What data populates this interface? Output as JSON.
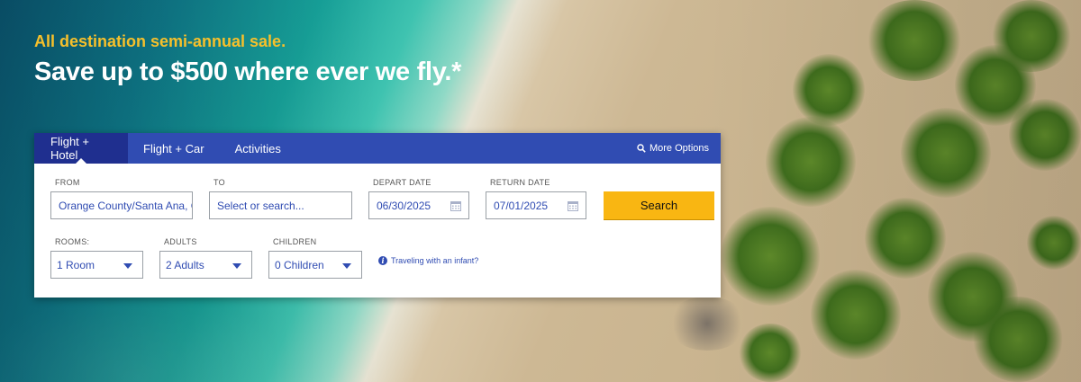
{
  "promo": {
    "kicker": "All destination semi-annual sale.",
    "headline": "Save up to $500 where ever we fly.*"
  },
  "tabs": [
    {
      "label": "Flight + Hotel",
      "active": true
    },
    {
      "label": "Flight + Car",
      "active": false
    },
    {
      "label": "Activities",
      "active": false
    }
  ],
  "more_options": {
    "label": "More Options",
    "icon": "search-icon"
  },
  "form": {
    "from": {
      "label": "FROM",
      "value": "Orange County/Santa Ana, C"
    },
    "to": {
      "label": "TO",
      "placeholder": "Select or search..."
    },
    "depart": {
      "label": "DEPART DATE",
      "value": "06/30/2025",
      "icon": "calendar-icon"
    },
    "return": {
      "label": "RETURN DATE",
      "value": "07/01/2025",
      "icon": "calendar-icon"
    },
    "search_label": "Search",
    "rooms": {
      "label": "ROOMS:",
      "value": "1 Room"
    },
    "adults": {
      "label": "ADULTS",
      "value": "2 Adults"
    },
    "children": {
      "label": "CHILDREN",
      "value": "0 Children"
    },
    "infant_link": "Traveling with an infant?"
  },
  "colors": {
    "accent_blue": "#304cb2",
    "active_tab": "#1f2f8f",
    "search_yellow": "#f9b612",
    "kicker_yellow": "#f7c02b"
  }
}
